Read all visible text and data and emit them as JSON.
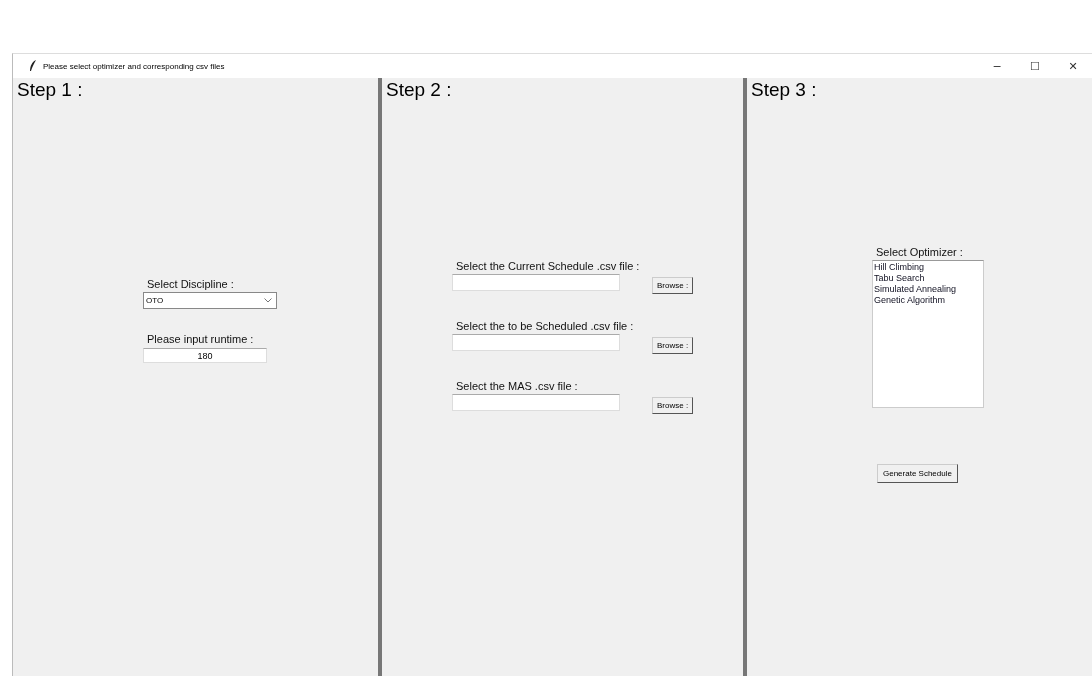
{
  "window": {
    "title": "Please select optimizer and corresponding csv files",
    "controls": [
      "−",
      "☐",
      "✕"
    ]
  },
  "step1": {
    "heading": "Step 1 :",
    "discipline_label": "Select Discipline :",
    "discipline_value": "OTO",
    "runtime_label": "Please input runtime :",
    "runtime_value": "180"
  },
  "step2": {
    "heading": "Step 2 :",
    "files": [
      {
        "label": "Select the Current Schedule .csv file :",
        "button": "Browse :"
      },
      {
        "label": "Select the to be Scheduled .csv file :",
        "button": "Browse :"
      },
      {
        "label": "Select the MAS .csv file :",
        "button": "Browse :"
      }
    ]
  },
  "step3": {
    "heading": "Step 3 :",
    "optimizer_label": "Select Optimizer :",
    "optimizers": [
      {
        "label": "Hill Climbing",
        "selected": false
      },
      {
        "label": "Tabu Search",
        "selected": false
      },
      {
        "label": "Simulated Annealing",
        "selected": false
      },
      {
        "label": "Genetic Algorithm",
        "selected": false
      }
    ],
    "button": "Generate Schedule"
  }
}
